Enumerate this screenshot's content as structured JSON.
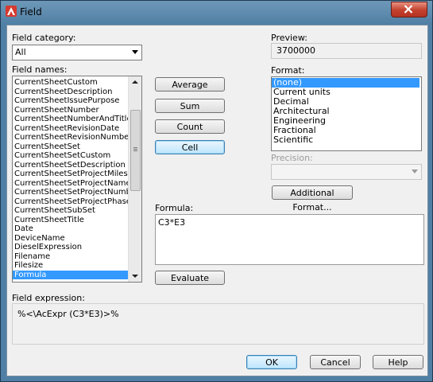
{
  "window": {
    "title": "Field"
  },
  "labels": {
    "field_category": "Field category:",
    "field_names": "Field names:",
    "preview": "Preview:",
    "format": "Format:",
    "precision": "Precision:",
    "formula": "Formula:",
    "field_expression": "Field expression:"
  },
  "category": {
    "selected": "All"
  },
  "field_names": [
    "CurrentSheetCustom",
    "CurrentSheetDescription",
    "CurrentSheetIssuePurpose",
    "CurrentSheetNumber",
    "CurrentSheetNumberAndTitle",
    "CurrentSheetRevisionDate",
    "CurrentSheetRevisionNumber",
    "CurrentSheetSet",
    "CurrentSheetSetCustom",
    "CurrentSheetSetDescription",
    "CurrentSheetSetProjectMilestone",
    "CurrentSheetSetProjectName",
    "CurrentSheetSetProjectNumber",
    "CurrentSheetSetProjectPhase",
    "CurrentSheetSubSet",
    "CurrentSheetTitle",
    "Date",
    "DeviceName",
    "DieselExpression",
    "Filename",
    "Filesize",
    "Formula"
  ],
  "field_names_selected": "Formula",
  "buttons": {
    "average": "Average",
    "sum": "Sum",
    "count": "Count",
    "cell": "Cell",
    "evaluate": "Evaluate",
    "additional_format": "Additional Format...",
    "ok": "OK",
    "cancel": "Cancel",
    "help": "Help"
  },
  "preview_value": "3700000",
  "format_options": [
    "(none)",
    "Current units",
    "Decimal",
    "Architectural",
    "Engineering",
    "Fractional",
    "Scientific"
  ],
  "format_selected": "(none)",
  "precision_value": "",
  "formula_value": "C3*E3",
  "field_expression_value": "%<\\AcExpr (C3*E3)>%",
  "colors": {
    "selection": "#3399ff",
    "title_bar": "#4f7fa4",
    "close_button": "#c2402d"
  }
}
